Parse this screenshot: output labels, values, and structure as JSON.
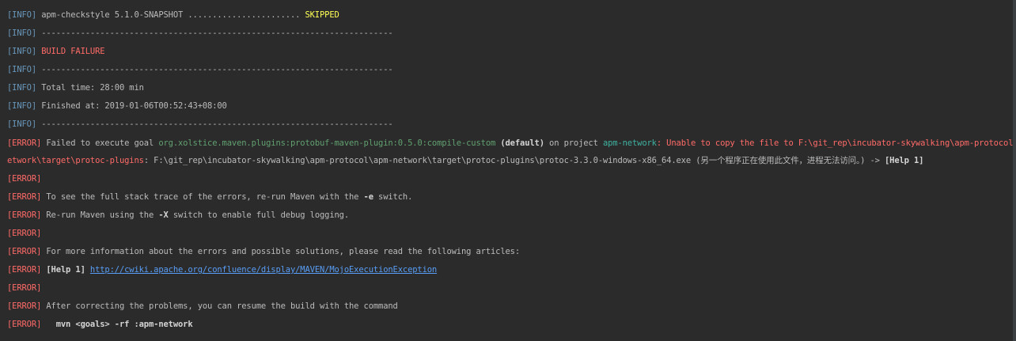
{
  "tags": {
    "info": "[INFO]",
    "error": "[ERROR]"
  },
  "l1": {
    "text": " apm-checkstyle 5.1.0-SNAPSHOT ....................... ",
    "status": "SKIPPED"
  },
  "l2": {
    "text": " ------------------------------------------------------------------------"
  },
  "l3": {
    "text": " BUILD FAILURE"
  },
  "l4": {
    "text": " ------------------------------------------------------------------------"
  },
  "l5": {
    "text": " Total time: 28:00 min"
  },
  "l6": {
    "text": " Finished at: 2019-01-06T00:52:43+08:00"
  },
  "l7": {
    "text": " ------------------------------------------------------------------------"
  },
  "l8": {
    "p1": " Failed to execute goal ",
    "goal": "org.xolstice.maven.plugins:protobuf-maven-plugin:0.5.0:compile-custom",
    "p2": " ",
    "default": "(default)",
    "p3": " on project ",
    "project": "apm-network",
    "p4": ": Unable to copy the file to F:\\git_rep\\incubator-skywalking\\apm-protocol\\apm-n"
  },
  "l9": {
    "p1": "etwork\\target\\protoc-plugins",
    "p2": ": F:\\git_rep\\incubator-skywalking\\apm-protocol\\apm-network\\target\\protoc-plugins\\protoc-3.3.0-windows-x86_64.exe (另一个程序正在使用此文件，进程无法访问。) -> ",
    "help": "[Help 1]"
  },
  "l10": {},
  "l11": {
    "p1": " To see the full stack trace of the errors, re-run Maven with the ",
    "flag": "-e",
    "p2": " switch."
  },
  "l12": {
    "p1": " Re-run Maven using the ",
    "flag": "-X",
    "p2": " switch to enable full debug logging."
  },
  "l13": {},
  "l14": {
    "text": " For more information about the errors and possible solutions, please read the following articles:"
  },
  "l15": {
    "help": " [Help 1] ",
    "url": "http://cwiki.apache.org/confluence/display/MAVEN/MojoExecutionException"
  },
  "l16": {},
  "l17": {
    "text": " After correcting the problems, you can resume the build with the command"
  },
  "l18": {
    "cmd": "   mvn <goals> -rf :apm-network"
  }
}
